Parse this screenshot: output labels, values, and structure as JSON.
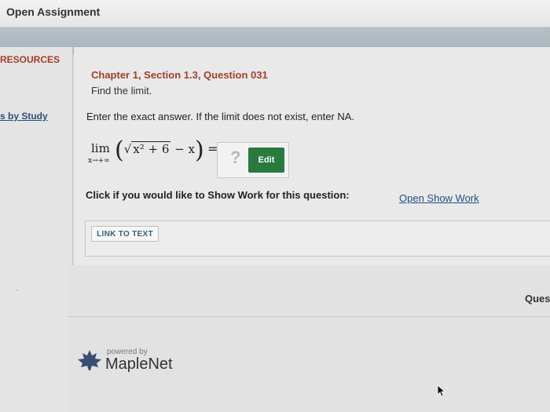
{
  "window": {
    "title": "Open Assignment"
  },
  "sidebar": {
    "resources_label": "RESOURCES",
    "study_link": "s by Study",
    "tiny_mark": "·"
  },
  "question": {
    "title": "Chapter 1, Section 1.3, Question 031",
    "subtitle": "Find the limit.",
    "instructions": "Enter the exact answer. If the limit does not exist, enter NA.",
    "math": {
      "lim": "lim",
      "lim_sub": "x→+∞",
      "radicand": "x² + 6",
      "minus_term": " − x",
      "equals": "="
    },
    "answer_placeholder": "?",
    "edit_label": "Edit",
    "show_work_prompt": "Click if you would like to Show Work for this question:",
    "show_work_link": "Open Show Work",
    "link_to_text_label": "LINK TO TEXT"
  },
  "right_cutoff": "Ques",
  "footer": {
    "powered_by": "powered by",
    "brand": "MapleNet"
  },
  "colors": {
    "accent_red": "#a3402d",
    "link_blue": "#1f4f8a",
    "edit_green": "#287a3d"
  },
  "icons": [
    "maple-leaf-icon",
    "mouse-cursor-icon"
  ]
}
